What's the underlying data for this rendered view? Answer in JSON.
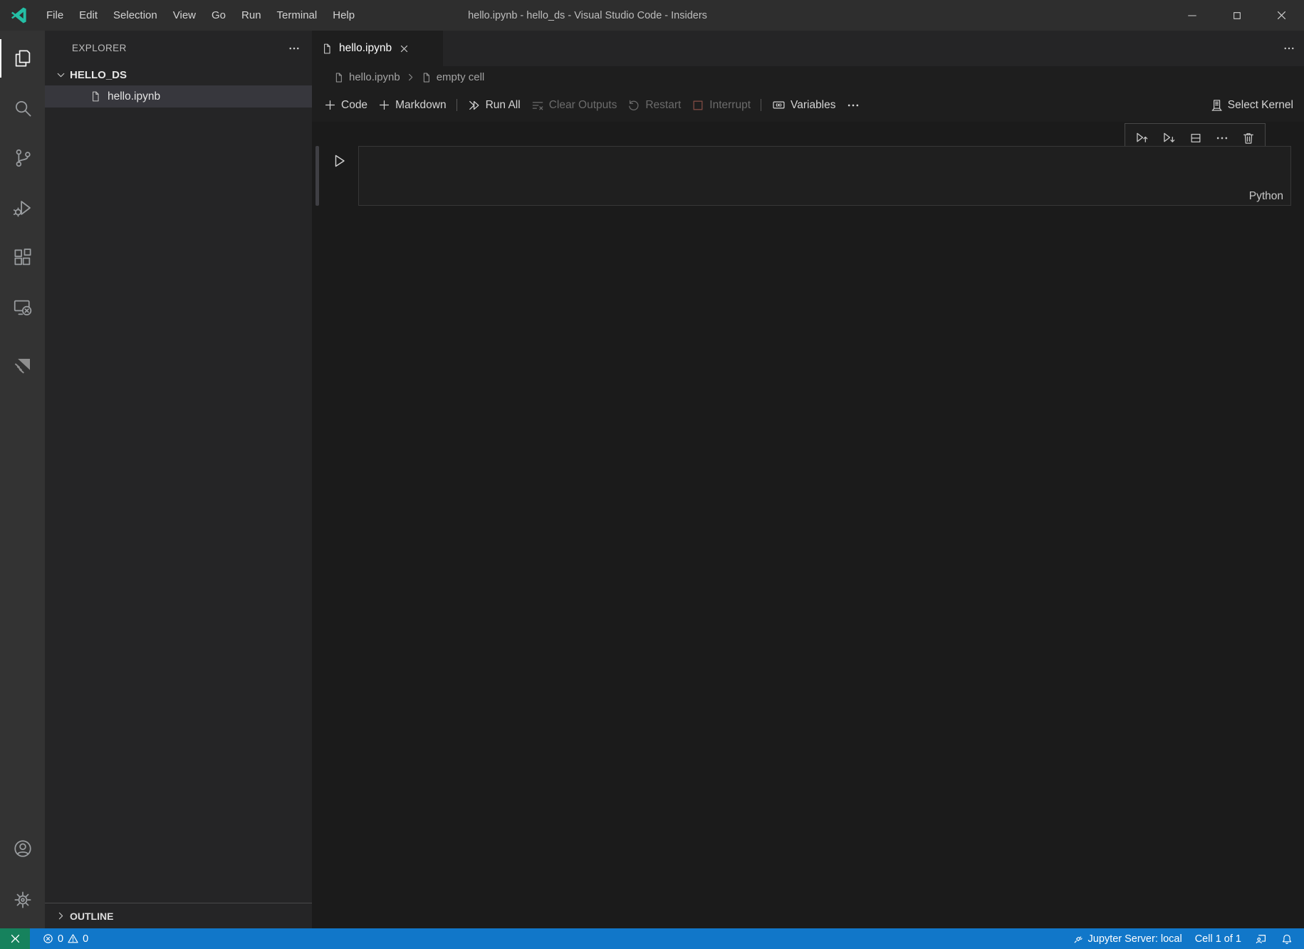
{
  "titlebar": {
    "title": "hello.ipynb - hello_ds - Visual Studio Code - Insiders",
    "menus": [
      "File",
      "Edit",
      "Selection",
      "View",
      "Go",
      "Run",
      "Terminal",
      "Help"
    ]
  },
  "activity_bar": {
    "active_item": "explorer",
    "icons": [
      "files-explorer-icon",
      "search-icon",
      "source-control-icon",
      "run-debug-icon",
      "extensions-icon",
      "remote-explorer-icon",
      "paper-plane-extension-icon",
      "account-icon",
      "settings-gear-icon"
    ]
  },
  "sidebar": {
    "header": "EXPLORER",
    "folder": "HELLO_DS",
    "file": "hello.ipynb",
    "outline": "OUTLINE"
  },
  "editor": {
    "tab": "hello.ipynb",
    "breadcrumb_file": "hello.ipynb",
    "breadcrumb_cell": "empty cell",
    "toolbar": {
      "code": "Code",
      "markdown": "Markdown",
      "run_all": "Run All",
      "clear_outputs": "Clear Outputs",
      "restart": "Restart",
      "interrupt": "Interrupt",
      "variables": "Variables",
      "select_kernel": "Select Kernel"
    },
    "cell": {
      "content": "",
      "language": "Python"
    }
  },
  "statusbar": {
    "errors": "0",
    "warnings": "0",
    "jupyter_server": "Jupyter Server: local",
    "cell_position": "Cell 1 of 1"
  },
  "colors": {
    "titlebar_bg": "#2e2e2e",
    "activitybar_bg": "#333333",
    "sidebar_bg": "#252526",
    "editor_bg": "#1e1e1e",
    "notebook_bg": "#1b1b1b",
    "selection_bg": "#37373d",
    "statusbar_blue": "#1177c9",
    "remote_green": "#16825d",
    "insiders_teal": "#24bfa5"
  }
}
